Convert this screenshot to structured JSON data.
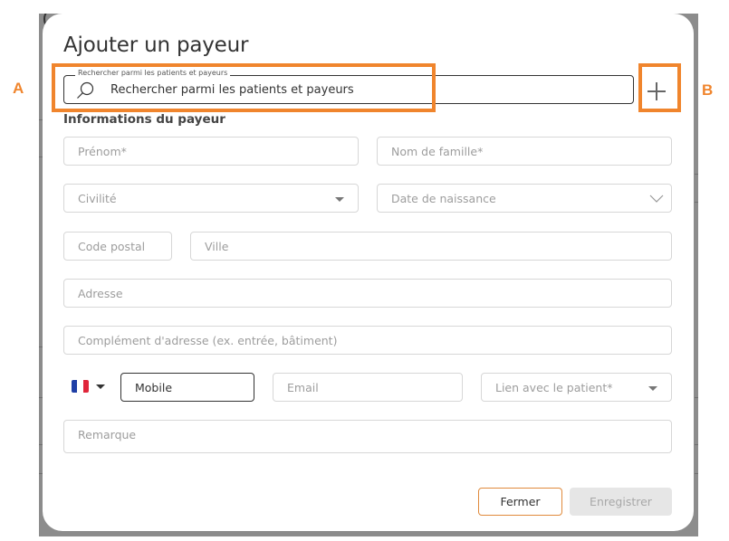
{
  "modal": {
    "title": "Ajouter un payeur",
    "search": {
      "legend": "Rechercher parmi les patients et payeurs",
      "placeholder": "Rechercher parmi les patients et payeurs"
    },
    "add_button_icon": "plus-icon",
    "section_title": "Informations du payeur",
    "fields": {
      "first_name": "Prénom*",
      "last_name": "Nom de famille*",
      "civility": "Civilité",
      "birth_date": "Date de naissance",
      "postal_code": "Code postal",
      "city": "Ville",
      "address": "Adresse",
      "address_complement": "Complément d'adresse (ex. entrée, bâtiment)",
      "mobile": "Mobile",
      "email": "Email",
      "relation": "Lien avec le patient*",
      "remark": "Remarque"
    },
    "phone_country_icon": "france-flag-icon",
    "buttons": {
      "close": "Fermer",
      "save": "Enregistrer"
    }
  },
  "annotations": {
    "label_a": "A",
    "label_b": "B",
    "color": "#f0852d"
  },
  "colors": {
    "accent": "#e08a3c",
    "backdrop": "#8c8c8c",
    "field_border": "#d7d7d7",
    "placeholder": "#9d9d9d"
  }
}
